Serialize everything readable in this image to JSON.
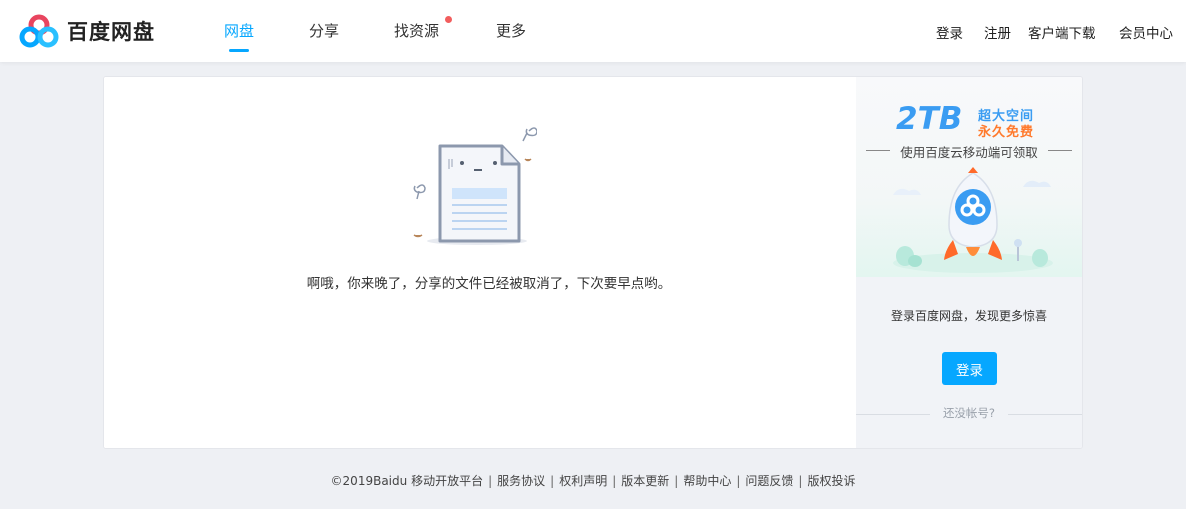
{
  "header": {
    "brand": "百度网盘",
    "nav": [
      {
        "label": "网盘",
        "active": true
      },
      {
        "label": "分享",
        "active": false
      },
      {
        "label": "找资源",
        "active": false,
        "badge": "red-dot"
      },
      {
        "label": "更多",
        "active": false
      }
    ],
    "right": [
      "登录",
      "注册",
      "客户端下载",
      "会员中心"
    ]
  },
  "main": {
    "message": "啊哦，你来晚了，分享的文件已经被取消了，下次要早点哟。",
    "illustration_icon": "sad-document-illustration"
  },
  "side": {
    "promo_big": "2TB",
    "promo_line1": "超大空间",
    "promo_line2": "永久免费",
    "promo_sub": "使用百度云移动端可领取",
    "promo_icon": "baidu-rocket-illustration",
    "tagline": "登录百度网盘，发现更多惊喜",
    "login_button": "登录",
    "no_account": "还没帐号?"
  },
  "footer": {
    "copyright": "©2019Baidu",
    "links": [
      "移动开放平台",
      "服务协议",
      "权利声明",
      "版本更新",
      "帮助中心",
      "问题反馈",
      "版权投诉"
    ]
  },
  "colors": {
    "accent": "#06a7ff",
    "badge": "#f25d5d",
    "promo_blue": "#3a9cf2",
    "promo_orange": "#ff7a2d"
  }
}
